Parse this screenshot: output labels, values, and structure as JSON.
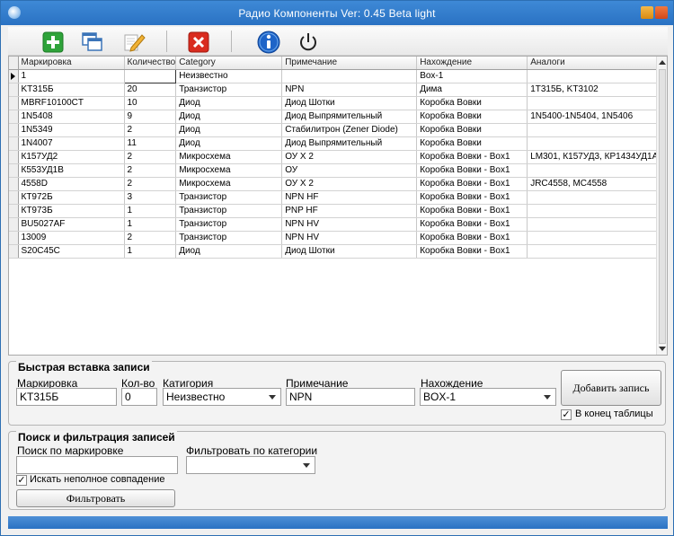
{
  "window": {
    "title": "Радио Компоненты Ver: 0.45 Beta light"
  },
  "toolbar": {
    "icons": [
      "add-icon",
      "copy-icon",
      "edit-icon",
      "delete-icon",
      "info-icon",
      "power-icon"
    ],
    "colors": {
      "add": "#2ea33a",
      "delete": "#d92c1f",
      "info": "#1e64c8"
    }
  },
  "table": {
    "columns": [
      "Маркировка",
      "Количество",
      "Category",
      "Примечание",
      "Нахождение",
      "Аналоги"
    ],
    "rows": [
      [
        "1",
        "",
        "Неизвестно",
        "",
        "Box-1",
        ""
      ],
      [
        "KT315Б",
        "20",
        "Транзистор",
        "NPN",
        "Дима",
        "1T315Б, KT3102"
      ],
      [
        "MBRF10100CT",
        "10",
        "Диод",
        "Диод Шотки",
        "Коробка Вовки",
        ""
      ],
      [
        "1N5408",
        "9",
        "Диод",
        "Диод Выпрямительный",
        "Коробка Вовки",
        "1N5400-1N5404, 1N5406"
      ],
      [
        "1N5349",
        "2",
        "Диод",
        "Стабилитрон (Zener Diode)",
        "Коробка Вовки",
        ""
      ],
      [
        "1N4007",
        "11",
        "Диод",
        "Диод Выпрямительный",
        "Коробка Вовки",
        ""
      ],
      [
        "К157УД2",
        "2",
        "Микросхема",
        "ОУ X 2",
        "Коробка Вовки - Box1",
        "LM301, К157УД3, КР1434УД1А"
      ],
      [
        "К553УД1В",
        "2",
        "Микросхема",
        "ОУ",
        "Коробка Вовки - Box1",
        ""
      ],
      [
        "4558D",
        "2",
        "Микросхема",
        "ОУ X 2",
        "Коробка Вовки - Box1",
        "JRC4558, MC4558"
      ],
      [
        "КТ972Б",
        "3",
        "Транзистор",
        "NPN  HF",
        "Коробка Вовки - Box1",
        ""
      ],
      [
        "КТ973Б",
        "1",
        "Транзистор",
        "PNP  HF",
        "Коробка Вовки - Box1",
        ""
      ],
      [
        "BU5027AF",
        "1",
        "Транзистор",
        "NPN  HV",
        "Коробка Вовки - Box1",
        ""
      ],
      [
        "13009",
        "2",
        "Транзистор",
        "NPN  HV",
        "Коробка Вовки - Box1",
        ""
      ],
      [
        "S20C45C",
        "1",
        "Диод",
        "Диод Шотки",
        "Коробка Вовки - Box1",
        ""
      ]
    ],
    "empty_rows": 7
  },
  "quick_insert": {
    "title": "Быстрая вставка записи",
    "marking_label": "Маркировка",
    "marking_value": "KT315Б",
    "qty_label": "Кол-во",
    "qty_value": "0",
    "category_label": "Катигория",
    "category_value": "Неизвестно",
    "note_label": "Примечание",
    "note_value": "NPN",
    "location_label": "Нахождение",
    "location_value": "BOX-1",
    "add_button": "Добавить запись",
    "end_of_table_label": "В конец таблицы",
    "end_of_table_checked": true
  },
  "search": {
    "title": "Поиск и фильтрация записей",
    "marking_search_label": "Поиск по маркировке",
    "marking_search_value": "",
    "category_filter_label": "Фильтровать по категории",
    "category_filter_value": "",
    "partial_match_label": "Искать неполное совпадение",
    "partial_match_checked": true,
    "filter_button": "Фильтровать"
  }
}
